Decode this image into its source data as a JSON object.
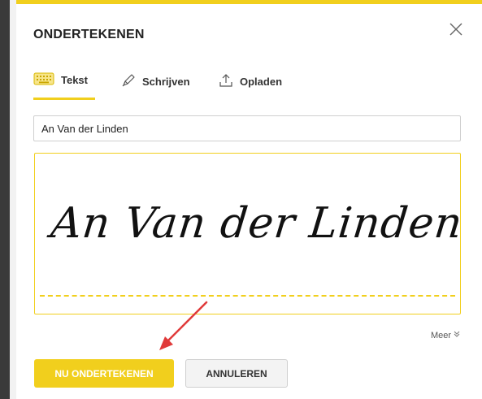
{
  "dialog": {
    "title": "ONDERTEKENEN",
    "close_icon": "close-icon",
    "accent_color": "#f1cf1d"
  },
  "tabs": [
    {
      "label": "Tekst",
      "icon": "keyboard-icon",
      "active": true
    },
    {
      "label": "Schrijven",
      "icon": "pen-icon",
      "active": false
    },
    {
      "label": "Opladen",
      "icon": "upload-icon",
      "active": false
    }
  ],
  "name_input": {
    "value": "An Van der Linden"
  },
  "signature": {
    "text": "An Van der Linden"
  },
  "more": {
    "label": "Meer",
    "icon": "double-chevron-down-icon"
  },
  "buttons": {
    "sign_label": "NU ONDERTEKENEN",
    "cancel_label": "ANNULEREN"
  },
  "annotation": {
    "color": "#e03a3a"
  }
}
